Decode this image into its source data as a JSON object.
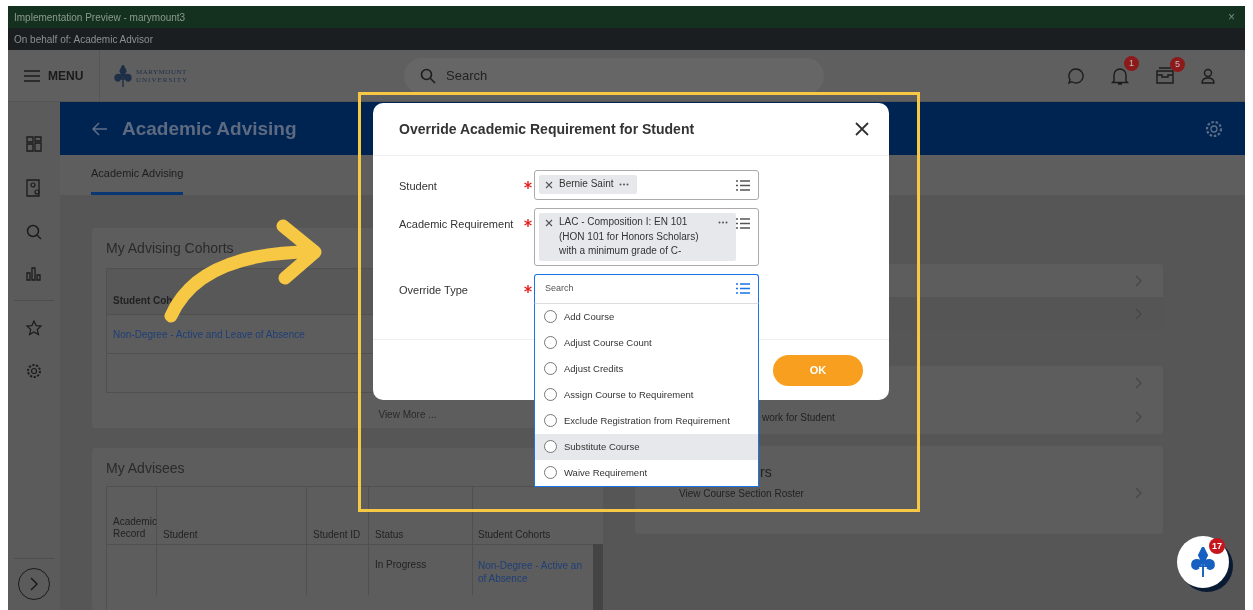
{
  "window": {
    "title": "Implementation Preview - marymount3",
    "close": "×"
  },
  "proxy_bar": {
    "text": "On behalf of: Academic Advisor"
  },
  "header": {
    "menu": "MENU",
    "logo": {
      "name": "MARYMOUNT",
      "sub": "UNIVERSITY"
    },
    "search": {
      "placeholder": "Search"
    },
    "notification_count": "1",
    "inbox_count": "5"
  },
  "banner": {
    "title": "Academic Advising"
  },
  "tabs": [
    {
      "label": "Academic Advising",
      "selected": true
    }
  ],
  "cohorts_card": {
    "title": "My Advising Cohorts",
    "column": "Student Coh",
    "rows": [
      "Non-Degree - Active and Leave of Absence"
    ],
    "view_more": "View More ..."
  },
  "advisees_card": {
    "title": "My Advisees",
    "columns": [
      "Academic Record",
      "Student",
      "Student ID",
      "Status",
      "Student Cohorts"
    ],
    "rows": [
      {
        "status": "In Progress",
        "cohort_lines": [
          "Non-Degree - Active an",
          "of Absence"
        ]
      }
    ]
  },
  "right_panel": {
    "task_link": "work for Student",
    "heading_fragment": "rs",
    "roster_link": "View Course Section Roster"
  },
  "dialog": {
    "title": "Override Academic Requirement for Student",
    "fields": [
      {
        "kind": "chip",
        "label": "Student",
        "required": true,
        "value": "Bernie Saint"
      },
      {
        "kind": "chip",
        "label": "Academic Requirement",
        "required": true,
        "value": "LAC - Composition I: EN 101 (HON 101 for Honors Scholars) with a minimum grade of C-"
      },
      {
        "kind": "search",
        "label": "Override Type",
        "required": true,
        "placeholder": "Search",
        "options": [
          {
            "label": "Add Course",
            "selected": false,
            "hovered": false
          },
          {
            "label": "Adjust Course Count",
            "selected": false,
            "hovered": false
          },
          {
            "label": "Adjust Credits",
            "selected": false,
            "hovered": false
          },
          {
            "label": "Assign Course to Requirement",
            "selected": false,
            "hovered": false
          },
          {
            "label": "Exclude Registration from Requirement",
            "selected": false,
            "hovered": false
          },
          {
            "label": "Substitute Course",
            "selected": false,
            "hovered": true
          },
          {
            "label": "Waive Requirement",
            "selected": false,
            "hovered": false
          }
        ]
      }
    ],
    "ok": "OK"
  },
  "assistant": {
    "badge": "17"
  }
}
